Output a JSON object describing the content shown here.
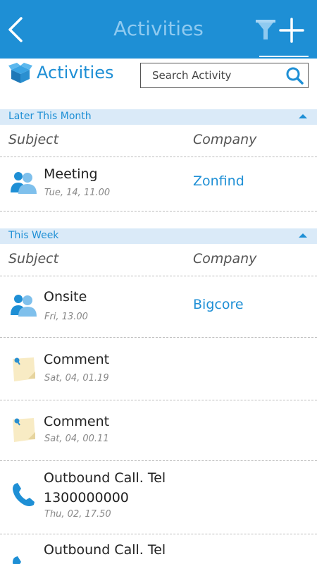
{
  "header": {
    "title": "Activities",
    "back_icon": "chevron-left-icon",
    "filter_icon": "filter-icon",
    "add_icon": "plus-icon",
    "bar_color": "#1e8fd5"
  },
  "subheader": {
    "title": "Activities",
    "search_placeholder": "Search Activity"
  },
  "columns": {
    "subject": "Subject",
    "company": "Company"
  },
  "sections": [
    {
      "title": "Later This Month",
      "items": [
        {
          "subject": "Meeting",
          "date": "Tue, 14, 11.00",
          "company": "Zonfind",
          "icon": "people-icon"
        }
      ]
    },
    {
      "title": "This Week",
      "items": [
        {
          "subject": "Onsite",
          "date": "Fri, 13.00",
          "company": "Bigcore",
          "icon": "people-icon"
        },
        {
          "subject": "Comment",
          "date": "Sat, 04, 01.19",
          "company": "",
          "icon": "sticky-note-icon"
        },
        {
          "subject": "Comment",
          "date": "Sat, 04, 00.11",
          "company": "",
          "icon": "sticky-note-icon"
        },
        {
          "subject": "Outbound Call. Tel 1300000000",
          "date": "Thu, 02, 17.50",
          "company": "",
          "icon": "phone-icon"
        },
        {
          "subject": "Outbound Call. Tel",
          "date": "",
          "company": "",
          "icon": "phone-icon"
        }
      ]
    }
  ]
}
